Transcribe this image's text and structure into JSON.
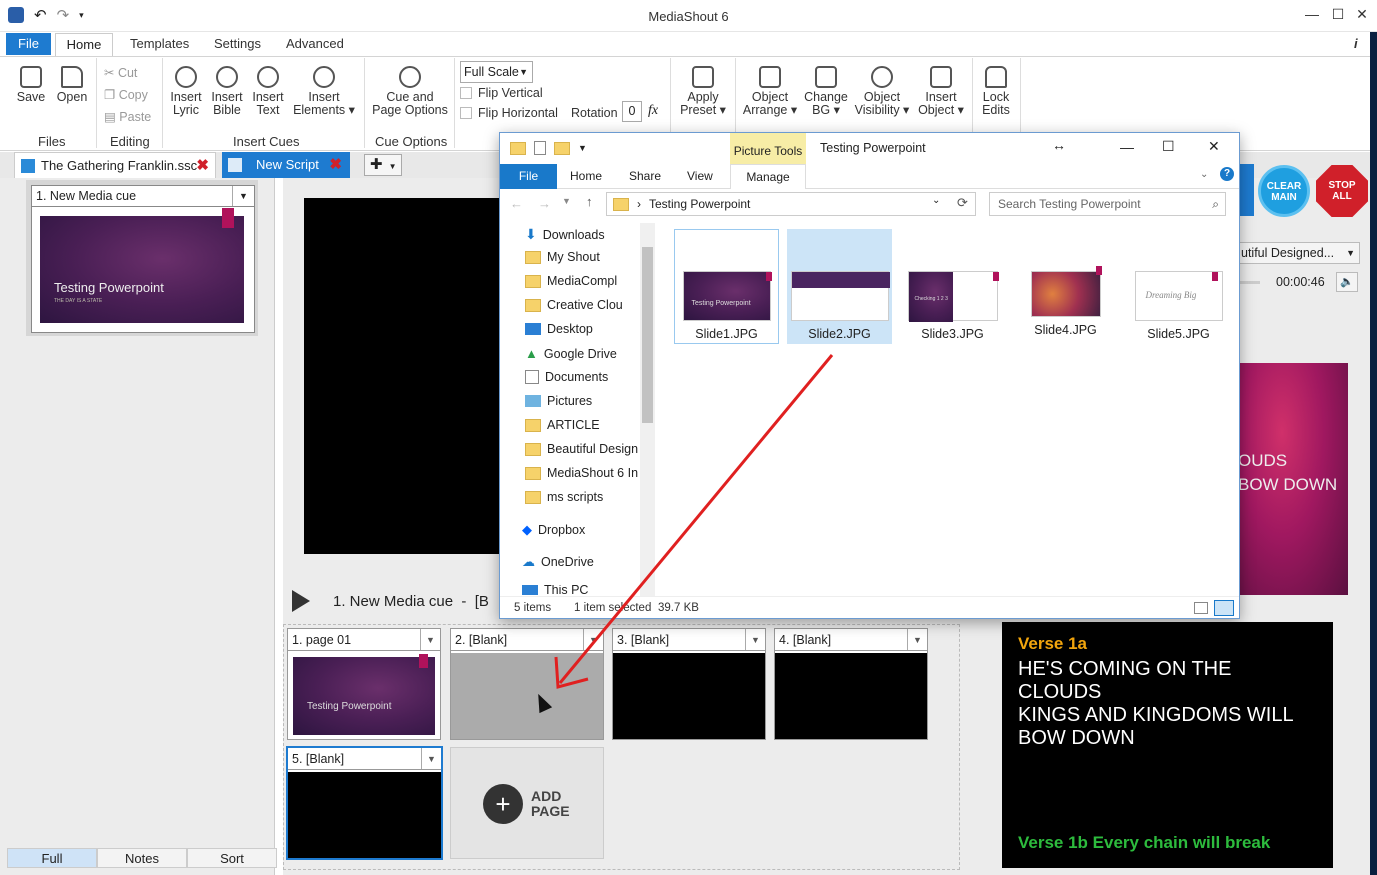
{
  "app": {
    "title": "MediaShout 6"
  },
  "window_controls": {
    "minimize": "—",
    "maximize": "☐",
    "close": "✕"
  },
  "menu": {
    "file": "File",
    "home": "Home",
    "templates": "Templates",
    "settings": "Settings",
    "advanced": "Advanced",
    "info": "i"
  },
  "ribbon": {
    "save": "Save",
    "open": "Open",
    "cut": "Cut",
    "copy": "Copy",
    "paste": "Paste",
    "insert_lyric": [
      "Insert",
      "Lyric"
    ],
    "insert_bible": [
      "Insert",
      "Bible"
    ],
    "insert_text": [
      "Insert",
      "Text"
    ],
    "insert_elements": [
      "Insert",
      "Elements ▾"
    ],
    "cue_page_options": [
      "Cue and",
      "Page Options"
    ],
    "full_scale": "Full Scale",
    "flip_vertical": "Flip Vertical",
    "flip_horizontal": "Flip Horizontal",
    "rotation": "Rotation",
    "rotation_value": "0",
    "fx": "fx",
    "apply_preset": [
      "Apply",
      "Preset ▾"
    ],
    "object_arrange": [
      "Object",
      "Arrange ▾"
    ],
    "change_bg": [
      "Change",
      "BG ▾"
    ],
    "object_visibility": [
      "Object",
      "Visibility ▾"
    ],
    "insert_object": [
      "Insert",
      "Object ▾"
    ],
    "lock_edits": [
      "Lock",
      "Edits"
    ],
    "groups": {
      "files": "Files",
      "editing": "Editing",
      "insert_cues": "Insert Cues",
      "cue_options": "Cue Options"
    }
  },
  "doc_tabs": [
    {
      "label": "The Gathering Franklin.ssc"
    },
    {
      "label": "New Script"
    }
  ],
  "cue_list": {
    "cue_label": "1. New Media cue",
    "slide_title": "Testing Powerpoint",
    "slide_sub": "THE DAY IS A STATE"
  },
  "bottom_tabs": [
    "Full",
    "Notes",
    "Sort"
  ],
  "center": {
    "cue_title": "1. New Media cue  -  [B",
    "pages": [
      "1. page 01",
      "2. [Blank]",
      "3. [Blank]",
      "4. [Blank]",
      "5. [Blank]"
    ],
    "page1_title": "Testing Powerpoint",
    "add_page": [
      "ADD",
      "PAGE"
    ]
  },
  "right": {
    "clear_main": [
      "CLEAR",
      "MAIN"
    ],
    "stop_all": [
      "STOP",
      "ALL"
    ],
    "theme": "utiful Designed...",
    "time": "00:00:46",
    "preview_lines": [
      "OUDS",
      "BOW DOWN"
    ],
    "verse_label": "Verse 1a",
    "lyrics": [
      "HE'S COMING ON THE",
      "CLOUDS",
      "KINGS AND KINGDOMS WILL",
      "BOW DOWN"
    ],
    "next_verse": "Verse 1b Every chain will break"
  },
  "explorer": {
    "title": "Testing Powerpoint",
    "picture_tools": "Picture Tools",
    "tabs": {
      "file": "File",
      "home": "Home",
      "share": "Share",
      "view": "View",
      "manage": "Manage"
    },
    "path": "Testing Powerpoint",
    "search_placeholder": "Search Testing Powerpoint",
    "nav": [
      "Downloads",
      "My Shout",
      "MediaCompl",
      "Creative Clou",
      "Desktop",
      "Google Drive",
      "Documents",
      "Pictures",
      "ARTICLE",
      "Beautiful Design",
      "MediaShout 6 In",
      "ms scripts",
      "Dropbox",
      "OneDrive",
      "This PC"
    ],
    "files": [
      "Slide1.JPG",
      "Slide2.JPG",
      "Slide3.JPG",
      "Slide4.JPG",
      "Slide5.JPG"
    ],
    "thumb_text": {
      "slide1": "Testing Powerpoint",
      "slide3": "Checking 1 2 3",
      "slide5": "Dreaming Big"
    },
    "status": {
      "items": "5 items",
      "selected": "1 item selected",
      "size": "39.7 KB"
    }
  },
  "colors": {
    "accent_blue": "#1e7bd0",
    "lyric_yellow": "#f2a50d",
    "lyric_green": "#2dbb3d",
    "stop_red": "#d0202a",
    "clear_blue": "#1f9fe0",
    "arrow_red": "#e02020"
  }
}
